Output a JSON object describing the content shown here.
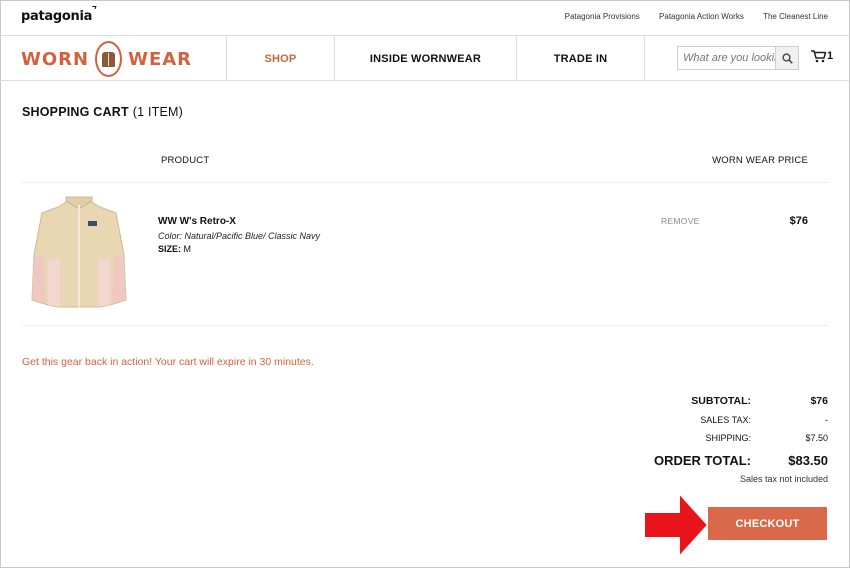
{
  "header": {
    "logo": "patagonia",
    "links": [
      "Patagonia Provisions",
      "Patagonia Action Works",
      "The Cleanest Line"
    ]
  },
  "nav": {
    "brand_left": "WORN",
    "brand_right": "WEAR",
    "items": [
      "SHOP",
      "INSIDE WORNWEAR",
      "TRADE IN"
    ],
    "search_placeholder": "What are you looking for?",
    "cart_count": "1"
  },
  "cart": {
    "title": "SHOPPING CART",
    "count_label": "(1 ITEM)",
    "col_product": "PRODUCT",
    "col_price": "WORN WEAR PRICE",
    "item": {
      "name": "WW W's Retro-X",
      "color": "Color: Natural/Pacific Blue/ Classic Navy",
      "size_label": "SIZE:",
      "size_value": "M",
      "remove": "REMOVE",
      "price": "$76"
    },
    "expire_msg": "Get this gear back in action! Your cart will expire in 30 minutes."
  },
  "summary": {
    "subtotal_label": "SUBTOTAL:",
    "subtotal_value": "$76",
    "tax_label": "SALES TAX:",
    "tax_value": "-",
    "shipping_label": "SHIPPING:",
    "shipping_value": "$7.50",
    "total_label": "ORDER TOTAL:",
    "total_value": "$83.50",
    "tax_note": "Sales tax not included"
  },
  "checkout_label": "CHECKOUT",
  "colors": {
    "accent": "#d0623f",
    "checkout": "#d9694a",
    "arrow": "#e8141a"
  }
}
